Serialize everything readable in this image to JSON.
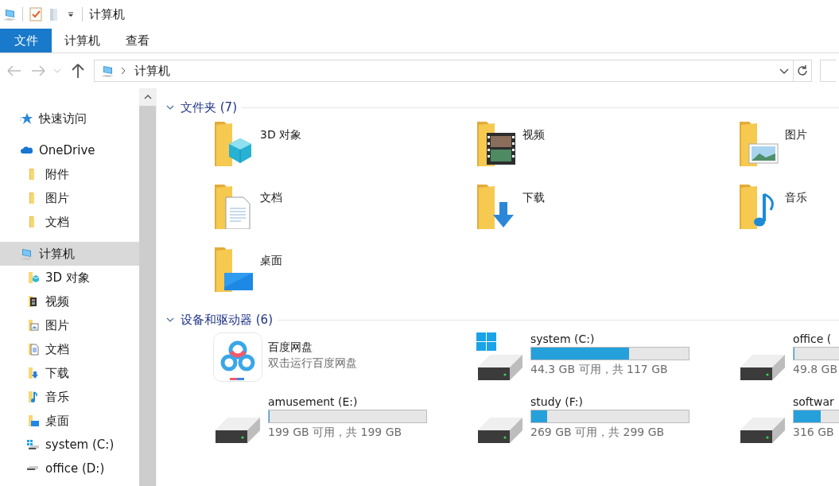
{
  "title_bar": {
    "title": "计算机"
  },
  "ribbon": {
    "tabs": [
      {
        "label": "文件",
        "kind": "file",
        "selected": false
      },
      {
        "label": "计算机",
        "kind": "tab",
        "selected": false
      },
      {
        "label": "查看",
        "kind": "tab",
        "selected": false
      }
    ]
  },
  "address_bar": {
    "crumbs": [
      "计算机"
    ]
  },
  "nav_tree": {
    "items": [
      {
        "label": "快速访问",
        "kind": "star",
        "selected": false
      },
      {
        "label": "OneDrive",
        "kind": "cloud",
        "selected": false,
        "children": [
          {
            "label": "附件",
            "kind": "folder",
            "selected": false
          },
          {
            "label": "图片",
            "kind": "folder",
            "selected": false
          },
          {
            "label": "文档",
            "kind": "folder",
            "selected": false
          }
        ]
      },
      {
        "label": "计算机",
        "kind": "pc",
        "selected": true,
        "children": [
          {
            "label": "3D 对象",
            "kind": "cube",
            "selected": false
          },
          {
            "label": "视频",
            "kind": "video",
            "selected": false
          },
          {
            "label": "图片",
            "kind": "pictures",
            "selected": false
          },
          {
            "label": "文档",
            "kind": "documents",
            "selected": false
          },
          {
            "label": "下载",
            "kind": "downloads",
            "selected": false
          },
          {
            "label": "音乐",
            "kind": "music",
            "selected": false
          },
          {
            "label": "桌面",
            "kind": "desktop",
            "selected": false
          },
          {
            "label": "system (C:)",
            "kind": "windows-drive",
            "selected": false
          },
          {
            "label": "office (D:)",
            "kind": "drive",
            "selected": false
          }
        ]
      }
    ]
  },
  "sections": [
    {
      "title": "文件夹 (7)",
      "expanded": true,
      "items": [
        {
          "kind": "cube",
          "name": "3D 对象"
        },
        {
          "kind": "video",
          "name": "视频"
        },
        {
          "kind": "pictures",
          "name": "图片"
        },
        {
          "kind": "documents",
          "name": "文档"
        },
        {
          "kind": "downloads",
          "name": "下载"
        },
        {
          "kind": "music",
          "name": "音乐"
        },
        {
          "kind": "desktop",
          "name": "桌面"
        }
      ]
    },
    {
      "title": "设备和驱动器 (6)",
      "expanded": true,
      "items": [
        {
          "kind": "app",
          "name": "百度网盘",
          "subtitle": "双击运行百度网盘"
        },
        {
          "kind": "windows-drive",
          "name": "system (C:)",
          "level": 0.62,
          "reading": "44.3 GB 可用，共 117 GB"
        },
        {
          "kind": "drive",
          "name": "office (",
          "level": 0.005,
          "reading": "49.8 GB"
        },
        {
          "kind": "drive",
          "name": "amusement (E:)",
          "level": 0.005,
          "reading": "199 GB 可用，共 199 GB"
        },
        {
          "kind": "drive",
          "name": "study (F:)",
          "level": 0.1,
          "reading": "269 GB 可用，共 299 GB"
        },
        {
          "kind": "drive",
          "name": "softwar",
          "level": 0.17,
          "reading": "316 GB"
        }
      ]
    }
  ]
}
